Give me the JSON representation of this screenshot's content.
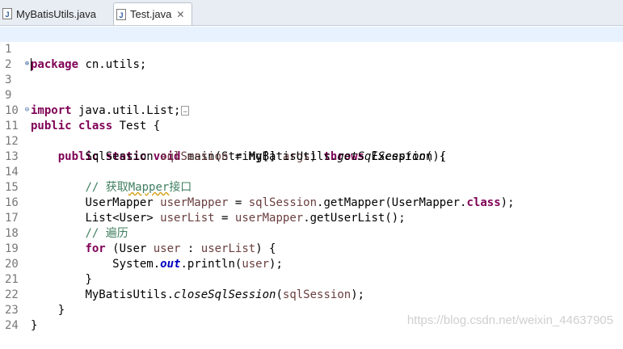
{
  "tabs": [
    {
      "label": "MyBatisUtils.java",
      "active": false,
      "icon": "java-file-icon"
    },
    {
      "label": "Test.java",
      "active": true,
      "icon": "java-file-icon"
    }
  ],
  "editor": {
    "lines": [
      {
        "n": "1",
        "t": "package cn.utils;"
      },
      {
        "n": "2",
        "t": ""
      },
      {
        "n": "3",
        "t": "import java.util.List;"
      },
      {
        "n": "9",
        "t": ""
      },
      {
        "n": "10",
        "t": "public class Test {"
      },
      {
        "n": "11",
        "t": "    public static void main(String[] args) throws Exception {"
      },
      {
        "n": "12",
        "t": "        SqlSession sqlSession = MyBatisUtils.getSqlSession();"
      },
      {
        "n": "13",
        "t": ""
      },
      {
        "n": "14",
        "t": "        // 获取Mapper接口"
      },
      {
        "n": "15",
        "t": "        UserMapper userMapper = sqlSession.getMapper(UserMapper.class);"
      },
      {
        "n": "16",
        "t": "        List<User> userList = userMapper.getUserList();"
      },
      {
        "n": "17",
        "t": "        // 遍历"
      },
      {
        "n": "18",
        "t": "        for (User user : userList) {"
      },
      {
        "n": "19",
        "t": "            System.out.println(user);"
      },
      {
        "n": "20",
        "t": "        }"
      },
      {
        "n": "21",
        "t": "        MyBatisUtils.closeSqlSession(sqlSession);"
      },
      {
        "n": "22",
        "t": "    }"
      },
      {
        "n": "23",
        "t": "}"
      },
      {
        "n": "24",
        "t": ""
      }
    ]
  },
  "tokens": {
    "l1_kw": "package",
    "l1_rest": " cn.utils;",
    "l3_kw": "import",
    "l3_rest": " java.util.List;",
    "l10_kw1": "public",
    "l10_kw2": "class",
    "l10_rest": " Test {",
    "l11_kw1": "public",
    "l11_kw2": "static",
    "l11_kw3": "void",
    "l11_a": " main(String[] ",
    "l11_var": "args",
    "l11_b": ") ",
    "l11_kw4": "throws",
    "l11_c": " Exception {",
    "l12_a": "SqlSession ",
    "l12_var": "sqlSession",
    "l12_b": " = MyBatisUtils.",
    "l12_it": "getSqlSession",
    "l12_c": "();",
    "l14_c1": "// 获取",
    "l14_c2": "Mapper",
    "l14_c3": "接口",
    "l15_a": "UserMapper ",
    "l15_var": "userMapper",
    "l15_b": " = ",
    "l15_var2": "sqlSession",
    "l15_c": ".getMapper(UserMapper.",
    "l15_kw": "class",
    "l15_d": ");",
    "l16_a": "List<User> ",
    "l16_var": "userList",
    "l16_b": " = ",
    "l16_var2": "userMapper",
    "l16_c": ".getUserList();",
    "l17_c": "// 遍历",
    "l18_kw": "for",
    "l18_a": " (User ",
    "l18_var": "user",
    "l18_b": " : ",
    "l18_var2": "userList",
    "l18_c": ") {",
    "l19_a": "System.",
    "l19_fld": "out",
    "l19_b": ".println(",
    "l19_var": "user",
    "l19_c": ");",
    "l20": "}",
    "l21_a": "MyBatisUtils.",
    "l21_it": "closeSqlSession",
    "l21_b": "(",
    "l21_var": "sqlSession",
    "l21_c": ");",
    "l22": "}",
    "l23": "}"
  },
  "watermark": "https://blog.csdn.net/weixin_44637905",
  "colors": {
    "keyword": "#7f0055",
    "comment": "#3f7f5f",
    "local_var": "#6a3e3e",
    "field": "#0000c0",
    "current_line": "#e8f2fe"
  }
}
